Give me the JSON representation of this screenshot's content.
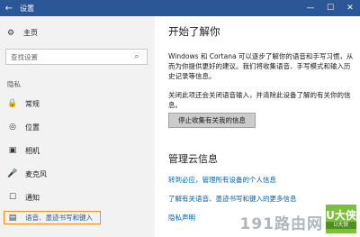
{
  "window": {
    "back_icon": "←",
    "title": "设置",
    "minimize_icon": "—",
    "maximize_icon": "☐",
    "close_icon": "✕"
  },
  "sidebar": {
    "home": {
      "icon": "⚙",
      "label": "主页"
    },
    "search": {
      "placeholder": "查找设置",
      "icon": "⌕"
    },
    "section_label": "隐私",
    "items": [
      {
        "icon": "🔒",
        "label": "常规"
      },
      {
        "icon": "◎",
        "label": "位置"
      },
      {
        "icon": "▣",
        "label": "相机"
      },
      {
        "icon": "🎤",
        "label": "麦克风"
      },
      {
        "icon": "☐",
        "label": "通知"
      }
    ],
    "active_item": {
      "icon": "▤",
      "label": "语音、墨迹书写和键入"
    }
  },
  "main": {
    "heading": "开始了解你",
    "paragraph1": "Windows 和 Cortana 可以逐步了解你的语音和手写习惯，从而为你提供更好的建议。我们将收集语音、手写模式和输入历史记录等信息。",
    "paragraph2": "关闭此项还会关闭语音输入，并清除此设备了解的有关你的信息。",
    "stop_button": "停止收集有关我的信息",
    "cloud_heading": "管理云信息",
    "links": [
      "转到必应，管理所有设备的个人信息",
      "了解有关语音、墨迹书写和键入的更多信息",
      "隐私声明"
    ]
  },
  "watermark": {
    "text": "191路由网",
    "logo_big": "U大侠",
    "logo_small": "U大侠"
  },
  "colors": {
    "titlebar": "#2b5797",
    "sidebar_bg": "#f2f2f2",
    "highlight": "#ff8c1a",
    "link": "#0063b1",
    "button_bg": "#cccccc"
  }
}
